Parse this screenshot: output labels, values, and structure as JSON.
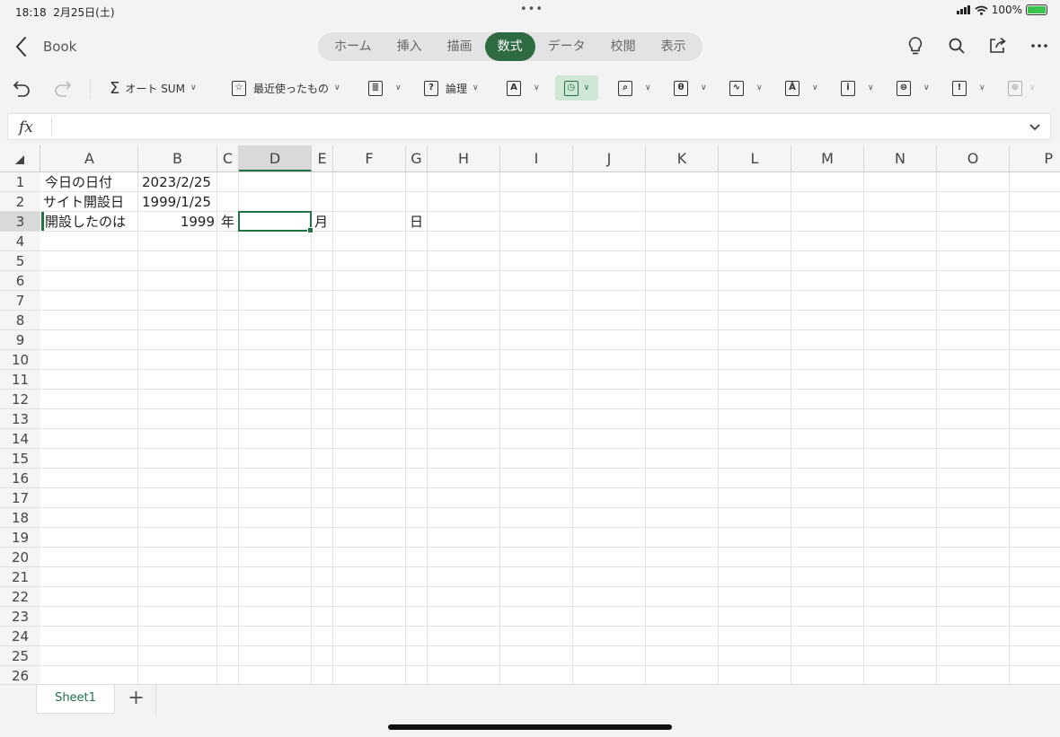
{
  "status_bar": {
    "time": "18:18",
    "date": "2月25日(土)",
    "battery": "100%"
  },
  "header": {
    "title": "Book",
    "tabs": [
      {
        "label": "ホーム"
      },
      {
        "label": "挿入"
      },
      {
        "label": "描画"
      },
      {
        "label": "数式",
        "active": true
      },
      {
        "label": "データ"
      },
      {
        "label": "校閲"
      },
      {
        "label": "表示"
      }
    ],
    "icons": [
      "lightbulb-icon",
      "search-icon",
      "share-icon",
      "more-icon"
    ]
  },
  "ribbon": {
    "autosum": "オート SUM",
    "recent": "最近使ったもの",
    "logical": "論理"
  },
  "formula_bar": {
    "label": "fx",
    "value": ""
  },
  "sheet": {
    "columns": [
      "A",
      "B",
      "C",
      "D",
      "E",
      "F",
      "G",
      "H",
      "I",
      "J",
      "K",
      "L",
      "M",
      "N",
      "O",
      "P"
    ],
    "rows": [
      "1",
      "2",
      "3",
      "4",
      "5",
      "6",
      "7",
      "8",
      "9",
      "10",
      "11",
      "12",
      "13",
      "14",
      "15",
      "16",
      "17",
      "18",
      "19",
      "20",
      "21",
      "22",
      "23",
      "24",
      "25",
      "26"
    ],
    "cells": {
      "A1": "今日の日付",
      "B1": "2023/2/25",
      "A2": "サイト開設日",
      "B2": "1999/1/25",
      "A3": "開設したのは",
      "B3": "1999",
      "C3": "年",
      "E3": "月",
      "G3": "日"
    },
    "selected": "D3"
  },
  "sheet_tabs": [
    {
      "label": "Sheet1",
      "active": true
    }
  ],
  "accent_color": "#217346"
}
